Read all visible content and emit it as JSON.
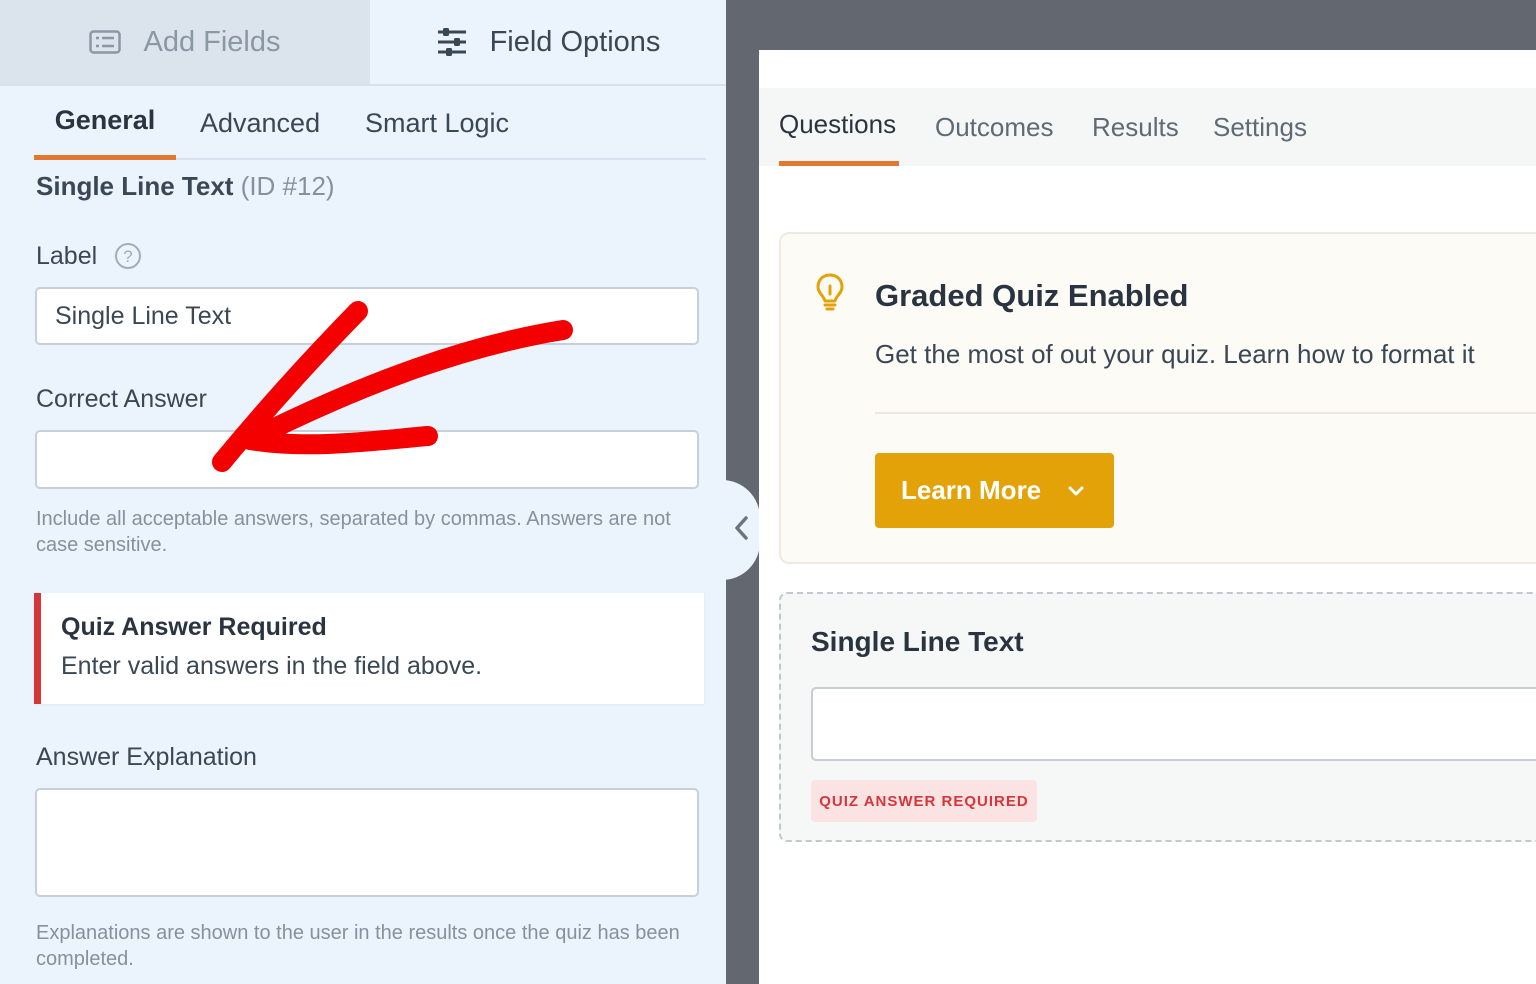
{
  "left_panel": {
    "top_tabs": {
      "add_fields": "Add Fields",
      "field_options": "Field Options"
    },
    "sub_tabs": {
      "general": "General",
      "advanced": "Advanced",
      "smart_logic": "Smart Logic"
    },
    "field_title": "Single Line Text",
    "field_id": "(ID #12)",
    "label_field": {
      "label": "Label",
      "value": "Single Line Text"
    },
    "correct_answer": {
      "label": "Correct Answer",
      "value": "",
      "help": "Include all acceptable answers, separated by commas. Answers are not case sensitive."
    },
    "alert": {
      "title": "Quiz Answer Required",
      "message": "Enter valid answers in the field above."
    },
    "answer_explanation": {
      "label": "Answer Explanation",
      "value": "",
      "help": "Explanations are shown to the user in the results once the quiz has been completed."
    }
  },
  "preview": {
    "tabs": {
      "questions": "Questions",
      "outcomes": "Outcomes",
      "results": "Results",
      "settings": "Settings"
    },
    "notice": {
      "title": "Graded Quiz Enabled",
      "text": "Get the most of out your quiz. Learn how to format it",
      "button": "Learn More"
    },
    "field": {
      "label": "Single Line Text",
      "badge": "QUIZ ANSWER REQUIRED"
    }
  },
  "colors": {
    "accent": "#e27730",
    "alert": "#d63638",
    "button": "#e3a308",
    "arrow": "#f50000"
  },
  "icons": [
    "list-icon",
    "sliders-icon",
    "help-icon",
    "bulb-icon",
    "chevron-down-icon",
    "chevron-left-icon"
  ]
}
